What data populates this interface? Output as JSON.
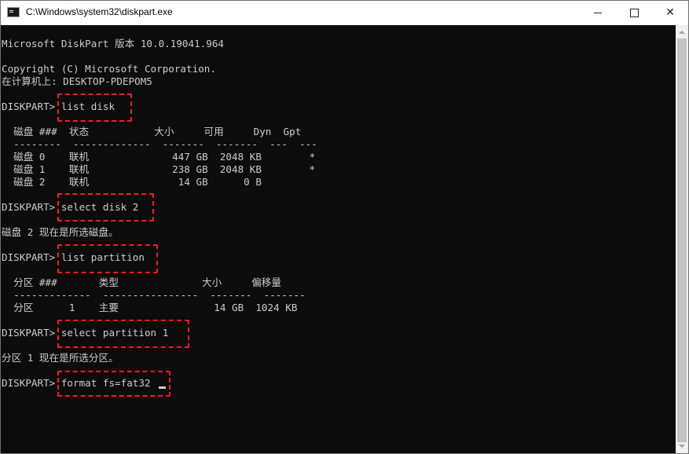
{
  "window": {
    "title": "C:\\Windows\\system32\\diskpart.exe",
    "controls": {
      "minimize": "—",
      "maximize": "☐",
      "close": "✕"
    }
  },
  "console": {
    "lines": [
      "Microsoft DiskPart 版本 10.0.19041.964",
      "",
      "Copyright (C) Microsoft Corporation.",
      "在计算机上: DESKTOP-PDEPOM5",
      "",
      "DISKPART> list disk",
      "",
      "  磁盘 ###  状态           大小     可用     Dyn  Gpt",
      "  --------  -------------  -------  -------  ---  ---",
      "  磁盘 0    联机              447 GB  2048 KB        *",
      "  磁盘 1    联机              238 GB  2048 KB        *",
      "  磁盘 2    联机               14 GB      0 B",
      "",
      "DISKPART> select disk 2",
      "",
      "磁盘 2 现在是所选磁盘。",
      "",
      "DISKPART> list partition",
      "",
      "  分区 ###       类型              大小     偏移量",
      "  -------------  ----------------  -------  -------",
      "  分区      1    主要                14 GB  1024 KB",
      "",
      "DISKPART> select partition 1",
      "",
      "分区 1 现在是所选分区。",
      "",
      "DISKPART> format fs=fat32"
    ]
  },
  "colors": {
    "console_bg": "#0c0c0c",
    "console_text": "#cccccc",
    "highlight": "#ff1a1a"
  },
  "icons": [
    "console-app-icon",
    "minimize-icon",
    "maximize-icon",
    "close-icon",
    "scroll-up-icon",
    "scroll-down-icon"
  ]
}
